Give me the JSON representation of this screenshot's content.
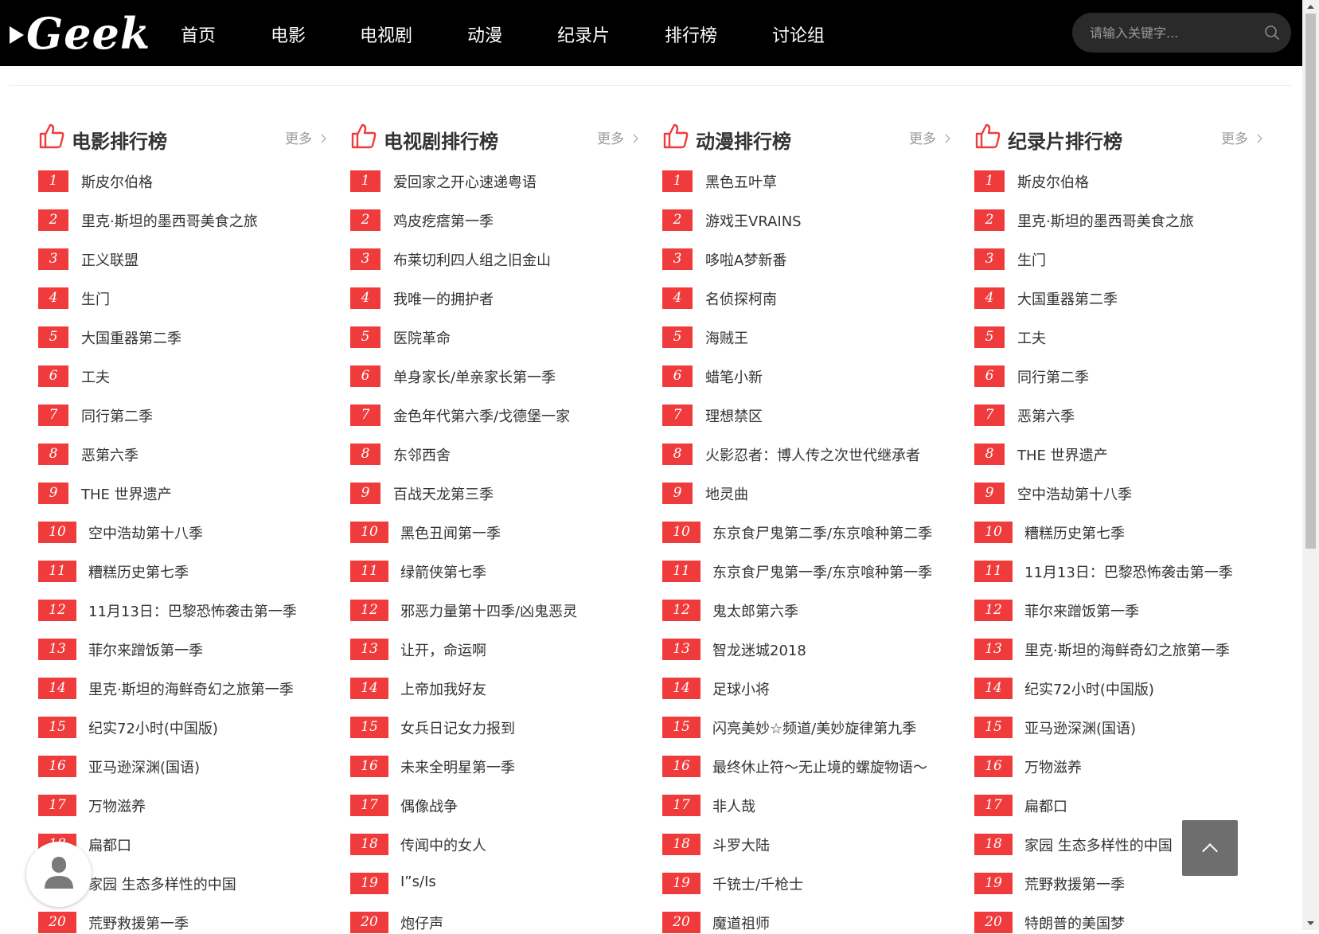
{
  "brand": {
    "logo_text": "Geek"
  },
  "nav": {
    "items": [
      "首页",
      "电影",
      "电视剧",
      "动漫",
      "纪录片",
      "排行榜",
      "讨论组"
    ]
  },
  "search": {
    "placeholder": "请输入关键字..."
  },
  "colors": {
    "accent": "#ef3b3b",
    "topbar": "#000000"
  },
  "columns": [
    {
      "title": "电影排行榜",
      "more": "更多",
      "items": [
        "斯皮尔伯格",
        "里克·斯坦的墨西哥美食之旅",
        "正义联盟",
        "生门",
        "大国重器第二季",
        "工夫",
        "同行第二季",
        "恶第六季",
        "THE 世界遗产",
        "空中浩劫第十八季",
        "糟糕历史第七季",
        "11月13日：巴黎恐怖袭击第一季",
        "菲尔来蹭饭第一季",
        "里克·斯坦的海鲜奇幻之旅第一季",
        "纪实72小时(中国版)",
        "亚马逊深渊(国语)",
        "万物滋养",
        "扁都口",
        "家园 生态多样性的中国",
        "荒野救援第一季"
      ]
    },
    {
      "title": "电视剧排行榜",
      "more": "更多",
      "items": [
        "爱回家之开心速递粤语",
        "鸡皮疙瘩第一季",
        "布莱切利四人组之旧金山",
        "我唯一的拥护者",
        "医院革命",
        "单身家长/单亲家长第一季",
        "金色年代第六季/戈德堡一家",
        "东邻西舍",
        "百战天龙第三季",
        "黑色丑闻第一季",
        "绿箭侠第七季",
        "邪恶力量第十四季/凶鬼恶灵",
        "让开，命运啊",
        "上帝加我好友",
        "女兵日记女力报到",
        "未来全明星第一季",
        "偶像战争",
        "传闻中的女人",
        "I”s/Is",
        "炮仔声"
      ]
    },
    {
      "title": "动漫排行榜",
      "more": "更多",
      "items": [
        "黑色五叶草",
        "游戏王VRAINS",
        "哆啦A梦新番",
        "名侦探柯南",
        "海贼王",
        "蜡笔小新",
        "理想禁区",
        "火影忍者：博人传之次世代继承者",
        "地灵曲",
        "东京食尸鬼第二季/东京喰种第二季",
        "东京食尸鬼第一季/东京喰种第一季",
        "鬼太郎第六季",
        "智龙迷城2018",
        "足球小将",
        "闪亮美妙☆频道/美妙旋律第九季",
        "最终休止符～无止境的螺旋物语～",
        "非人哉",
        "斗罗大陆",
        "千铳士/千枪士",
        "魔道祖师"
      ]
    },
    {
      "title": "纪录片排行榜",
      "more": "更多",
      "items": [
        "斯皮尔伯格",
        "里克·斯坦的墨西哥美食之旅",
        "生门",
        "大国重器第二季",
        "工夫",
        "同行第二季",
        "恶第六季",
        "THE 世界遗产",
        "空中浩劫第十八季",
        "糟糕历史第七季",
        "11月13日：巴黎恐怖袭击第一季",
        "菲尔来蹭饭第一季",
        "里克·斯坦的海鲜奇幻之旅第一季",
        "纪实72小时(中国版)",
        "亚马逊深渊(国语)",
        "万物滋养",
        "扁都口",
        "家园 生态多样性的中国",
        "荒野救援第一季",
        "特朗普的美国梦"
      ]
    }
  ]
}
